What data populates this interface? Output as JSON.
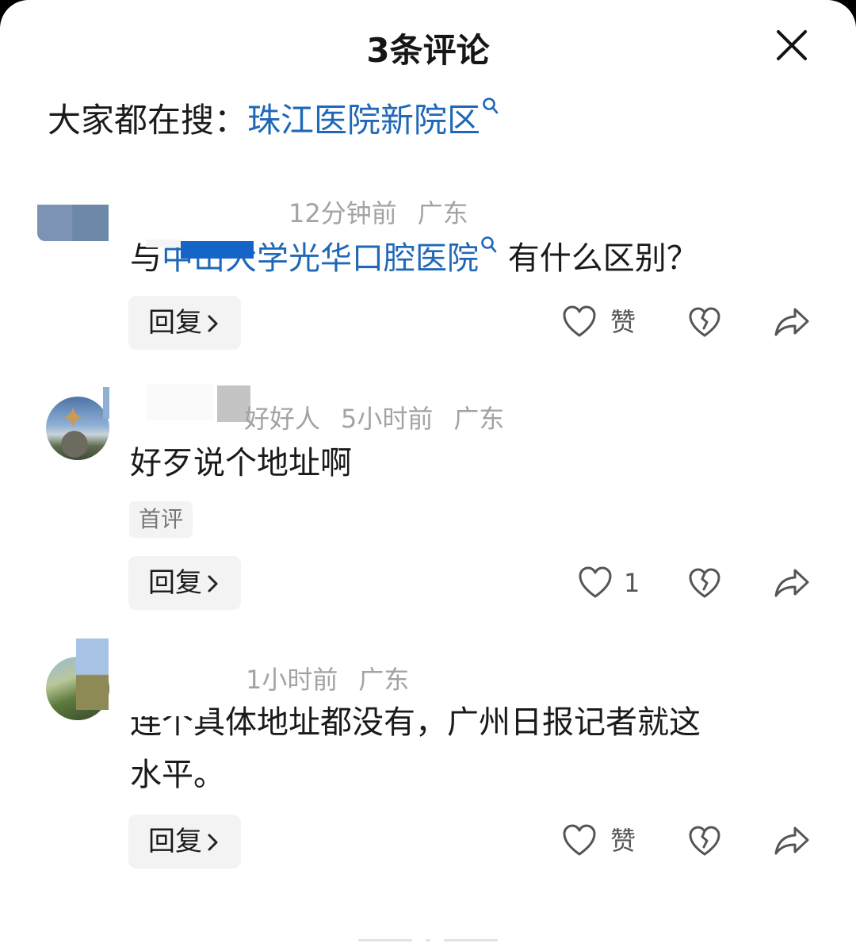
{
  "header": {
    "title": "3条评论",
    "close_icon": "close-icon"
  },
  "hot_search": {
    "prefix": "大家都在搜：",
    "link": "珠江医院新院区",
    "icon": "search-icon"
  },
  "comments": [
    {
      "meta_time": "12分钟前",
      "meta_region": "广东",
      "text_prefix": "与",
      "text_link": "中山大学光华口腔医院",
      "text_suffix": "有什么区别？",
      "reply_label": "回复",
      "like_label": "赞"
    },
    {
      "meta_name_tail": "好好人",
      "meta_time": "5小时前",
      "meta_region": "广东",
      "text": "好歹说个地址啊",
      "tag": "首评",
      "reply_label": "回复",
      "like_label": "1"
    },
    {
      "meta_time": "1小时前",
      "meta_region": "广东",
      "text_line1": "连个具体地址都没有，广州日报记者就这",
      "text_line2": "水平。",
      "reply_label": "回复",
      "like_label": "赞"
    }
  ],
  "icons": {
    "like": "heart-icon",
    "dislike": "broken-heart-icon",
    "share": "share-icon",
    "chevron": "chevron-right-icon"
  },
  "colors": {
    "link": "#1f68b8",
    "meta": "#a3a3a3",
    "button_bg": "#f3f3f3"
  }
}
